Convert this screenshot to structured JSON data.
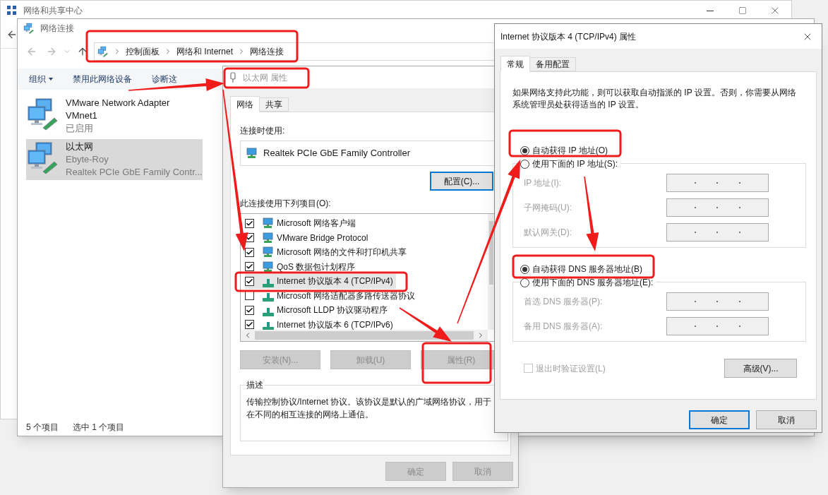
{
  "background_window": {
    "title": "网络和共享中心"
  },
  "explorer": {
    "title": "网络连接",
    "breadcrumb": [
      "控制面板",
      "网络和 Internet",
      "网络连接"
    ],
    "toolbar": [
      {
        "label": "组织",
        "dropdown": true
      },
      {
        "label": "禁用此网络设备",
        "dropdown": false
      },
      {
        "label": "诊断这",
        "dropdown": false
      }
    ],
    "adapters": [
      {
        "name": "VMware Network Adapter VMnet1",
        "details": [
          "已启用"
        ],
        "selected": false
      },
      {
        "name": "以太网",
        "details": [
          "Ebyte-Roy",
          "Realtek PCIe GbE Family Contr..."
        ],
        "selected": true
      }
    ],
    "status_bar": [
      "5 个项目",
      "选中 1 个项目"
    ]
  },
  "ethernet_dialog": {
    "title": "以太网 属性",
    "tabs": [
      {
        "label": "网络",
        "selected": true
      },
      {
        "label": "共享",
        "selected": false
      }
    ],
    "connect_using_label": "连接时使用:",
    "adapter": "Realtek PCIe GbE Family Controller",
    "configure_button": "配置(C)...",
    "items_label": "此连接使用下列项目(O):",
    "items": [
      {
        "label": "Microsoft 网络客户端",
        "kind": "service",
        "checked": true,
        "selected": false
      },
      {
        "label": "VMware Bridge Protocol",
        "kind": "service",
        "checked": true,
        "selected": false
      },
      {
        "label": "Microsoft 网络的文件和打印机共享",
        "kind": "service",
        "checked": true,
        "selected": false
      },
      {
        "label": "QoS 数据包计划程序",
        "kind": "service",
        "checked": true,
        "selected": false
      },
      {
        "label": "Internet 协议版本 4 (TCP/IPv4)",
        "kind": "protocol",
        "checked": true,
        "selected": true
      },
      {
        "label": "Microsoft 网络适配器多路传送器协议",
        "kind": "protocol",
        "checked": false,
        "selected": false
      },
      {
        "label": "Microsoft LLDP 协议驱动程序",
        "kind": "protocol",
        "checked": true,
        "selected": false
      },
      {
        "label": "Internet 协议版本 6 (TCP/IPv6)",
        "kind": "protocol",
        "checked": true,
        "selected": false
      }
    ],
    "buttons": [
      {
        "label": "安装(N)...",
        "disabled": true
      },
      {
        "label": "卸载(U)",
        "disabled": true
      },
      {
        "label": "属性(R)",
        "disabled": true
      }
    ],
    "description_label": "描述",
    "description": "传输控制协议/Internet 协议。该协议是默认的广域网络协议，用于在不同的相互连接的网络上通信。",
    "footer_buttons": [
      {
        "label": "确定",
        "disabled": true
      },
      {
        "label": "取消",
        "disabled": true
      }
    ]
  },
  "ipv4_dialog": {
    "title": "Internet 协议版本 4 (TCP/IPv4) 属性",
    "tabs": [
      {
        "label": "常规",
        "selected": true
      },
      {
        "label": "备用配置",
        "selected": false
      }
    ],
    "intro": "如果网络支持此功能，则可以获取自动指派的 IP 设置。否则，你需要从网络系统管理员处获得适当的 IP 设置。",
    "ip_options": [
      {
        "label": "自动获得 IP 地址(O)",
        "selected": true
      },
      {
        "label": "使用下面的 IP 地址(S):",
        "selected": false
      }
    ],
    "ip_fields": [
      {
        "label": "IP 地址(I):",
        "disabled": true
      },
      {
        "label": "子网掩码(U):",
        "disabled": true
      },
      {
        "label": "默认网关(D):",
        "disabled": true
      }
    ],
    "dns_options": [
      {
        "label": "自动获得 DNS 服务器地址(B)",
        "selected": true
      },
      {
        "label": "使用下面的 DNS 服务器地址(E):",
        "selected": false
      }
    ],
    "dns_fields": [
      {
        "label": "首选 DNS 服务器(P):",
        "disabled": true
      },
      {
        "label": "备用 DNS 服务器(A):",
        "disabled": true
      }
    ],
    "validate": {
      "label": "退出时验证设置(L)",
      "checked": false,
      "disabled": true
    },
    "advanced_button": "高级(V)...",
    "buttons": [
      {
        "label": "确定",
        "default": true
      },
      {
        "label": "取消",
        "default": false
      }
    ]
  }
}
